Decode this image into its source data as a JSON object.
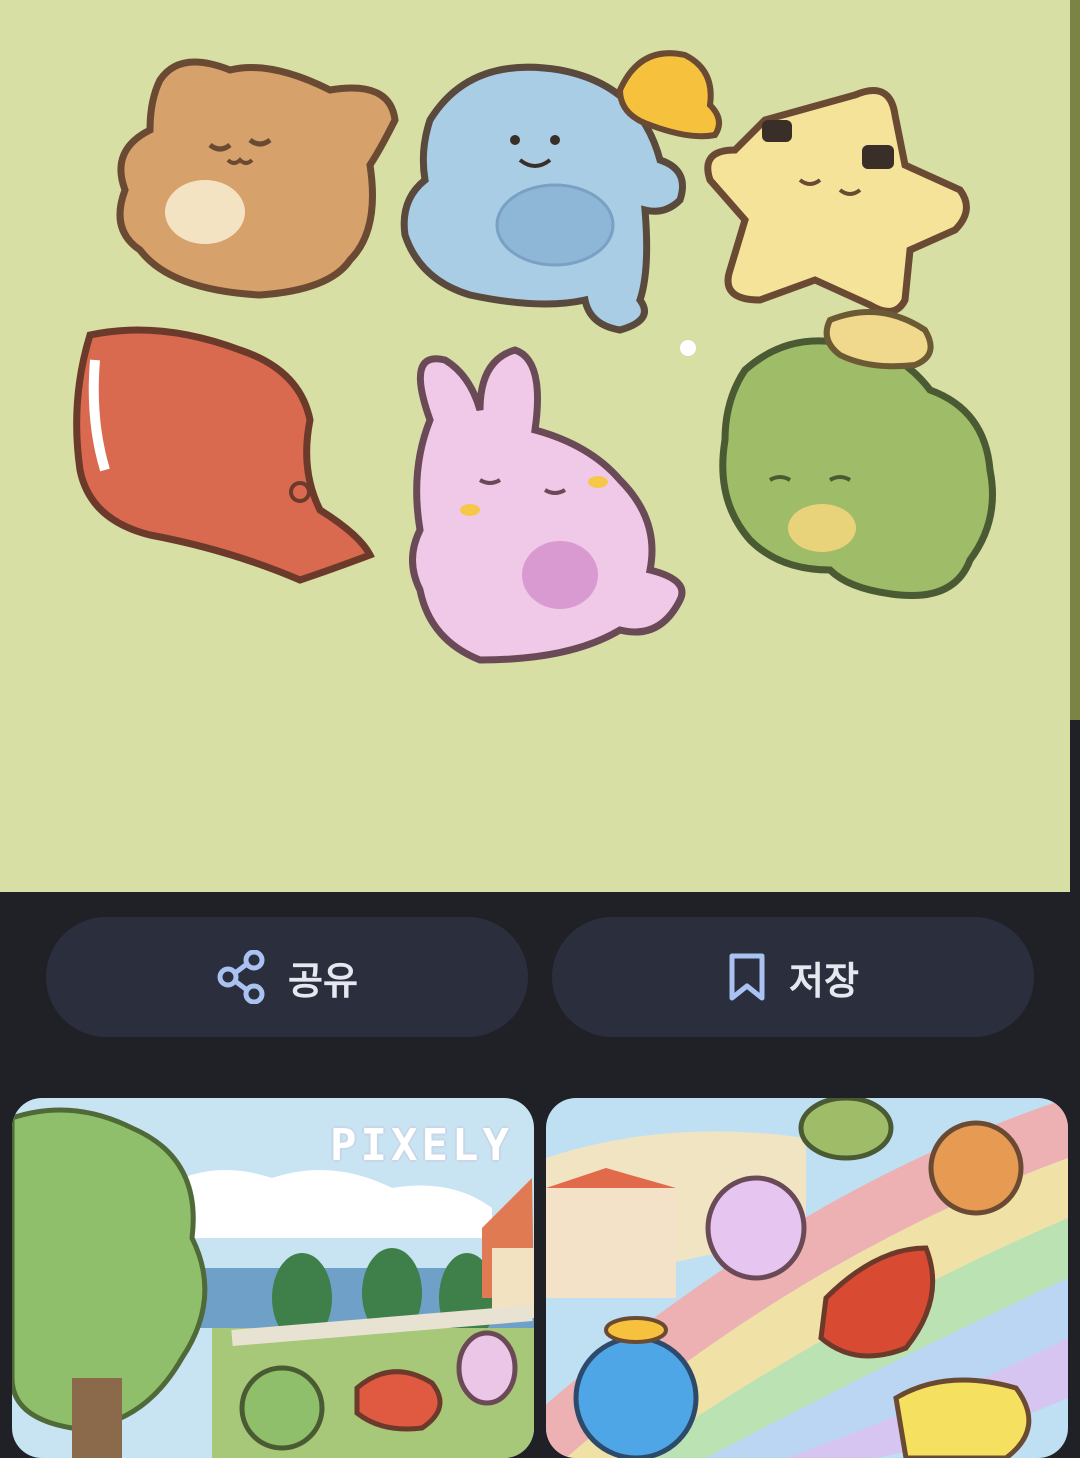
{
  "actions": {
    "share_label": "공유",
    "save_label": "저장"
  },
  "related": {
    "left_thumb_text": "PIXELY"
  },
  "colors": {
    "page_background": "#1f2127",
    "hero_background": "#d7dfa4",
    "pill_background": "#2b2f3d",
    "icon_accent": "#a9c2f2"
  },
  "icons": [
    "share-icon",
    "bookmark-icon"
  ]
}
